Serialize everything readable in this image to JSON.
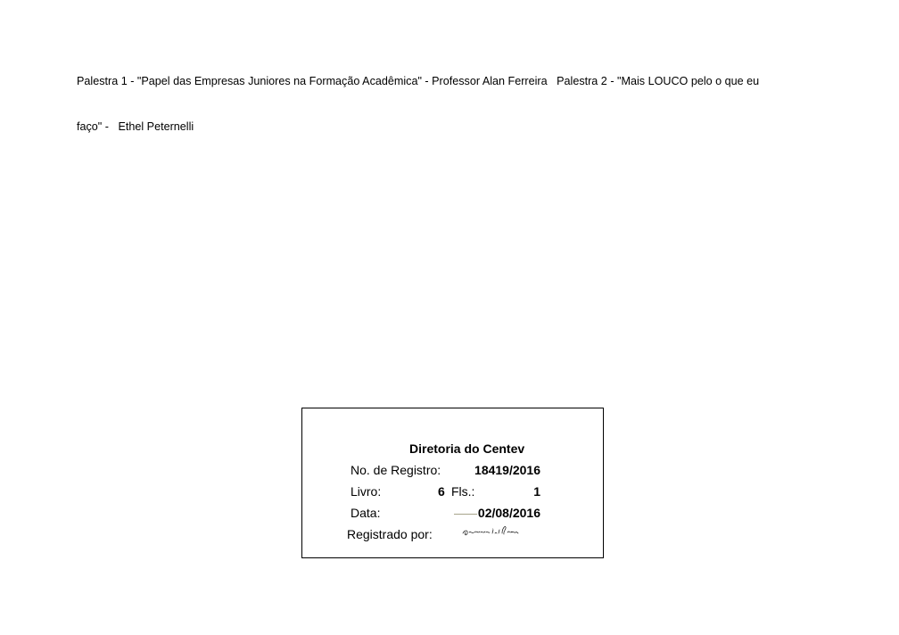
{
  "header": {
    "line1": "Palestra 1 - \"Papel das Empresas Juniores na Formação Acadêmica\" - Professor Alan Ferreira   Palestra 2 - \"Mais LOUCO pelo o que eu",
    "line2": "faço\" -   Ethel Peternelli"
  },
  "registration": {
    "title": "Diretoria do Centev",
    "registro_label": "No. de Registro:",
    "registro_value": "18419/2016",
    "livro_label": "Livro:",
    "livro_value": "6",
    "fls_label": "Fls.:",
    "fls_value": "1",
    "data_label": "Data:",
    "data_value": "02/08/2016",
    "registrado_label": "Registrado por:",
    "signature_text": "Geovane S. B. Júnior"
  }
}
